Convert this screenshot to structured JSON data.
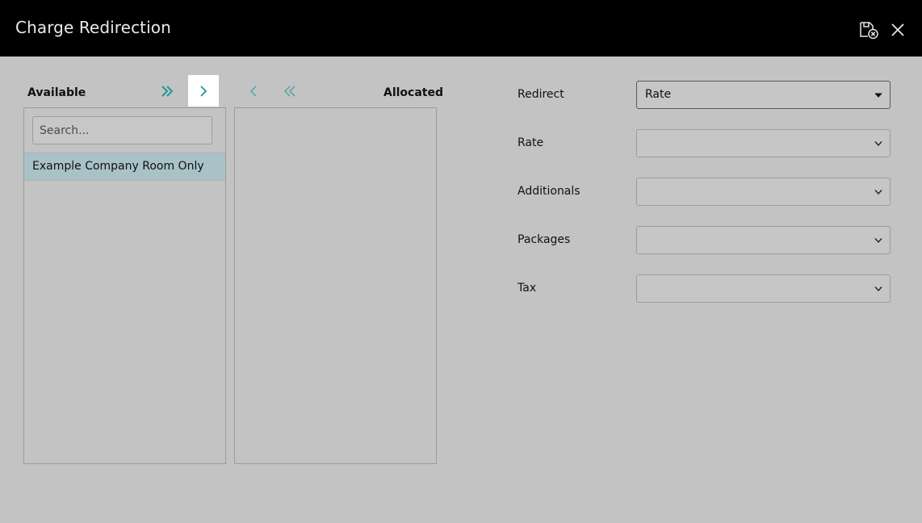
{
  "header": {
    "title": "Charge Redirection",
    "save_icon": "save-cancel-icon",
    "close_icon": "close-icon"
  },
  "available": {
    "heading": "Available",
    "search_placeholder": "Search...",
    "items": [
      {
        "label": "Example Company Room Only",
        "selected": true
      }
    ]
  },
  "allocated": {
    "heading": "Allocated",
    "items": []
  },
  "transfer_buttons": [
    {
      "name": "move-all-right",
      "icon": "double-chevron-right-icon"
    },
    {
      "name": "move-right",
      "icon": "chevron-right-icon",
      "highlighted": true
    },
    {
      "name": "move-left",
      "icon": "chevron-left-icon"
    },
    {
      "name": "move-all-left",
      "icon": "double-chevron-left-icon"
    }
  ],
  "form": {
    "redirect": {
      "label": "Redirect",
      "value": "Rate"
    },
    "rate": {
      "label": "Rate",
      "value": ""
    },
    "additionals": {
      "label": "Additionals",
      "value": ""
    },
    "packages": {
      "label": "Packages",
      "value": ""
    },
    "tax": {
      "label": "Tax",
      "value": ""
    }
  },
  "colors": {
    "titlebar": "#000000",
    "background": "#c3c3c3",
    "accent": "#1a9a9a",
    "selected_row": "#a9c2c7"
  }
}
